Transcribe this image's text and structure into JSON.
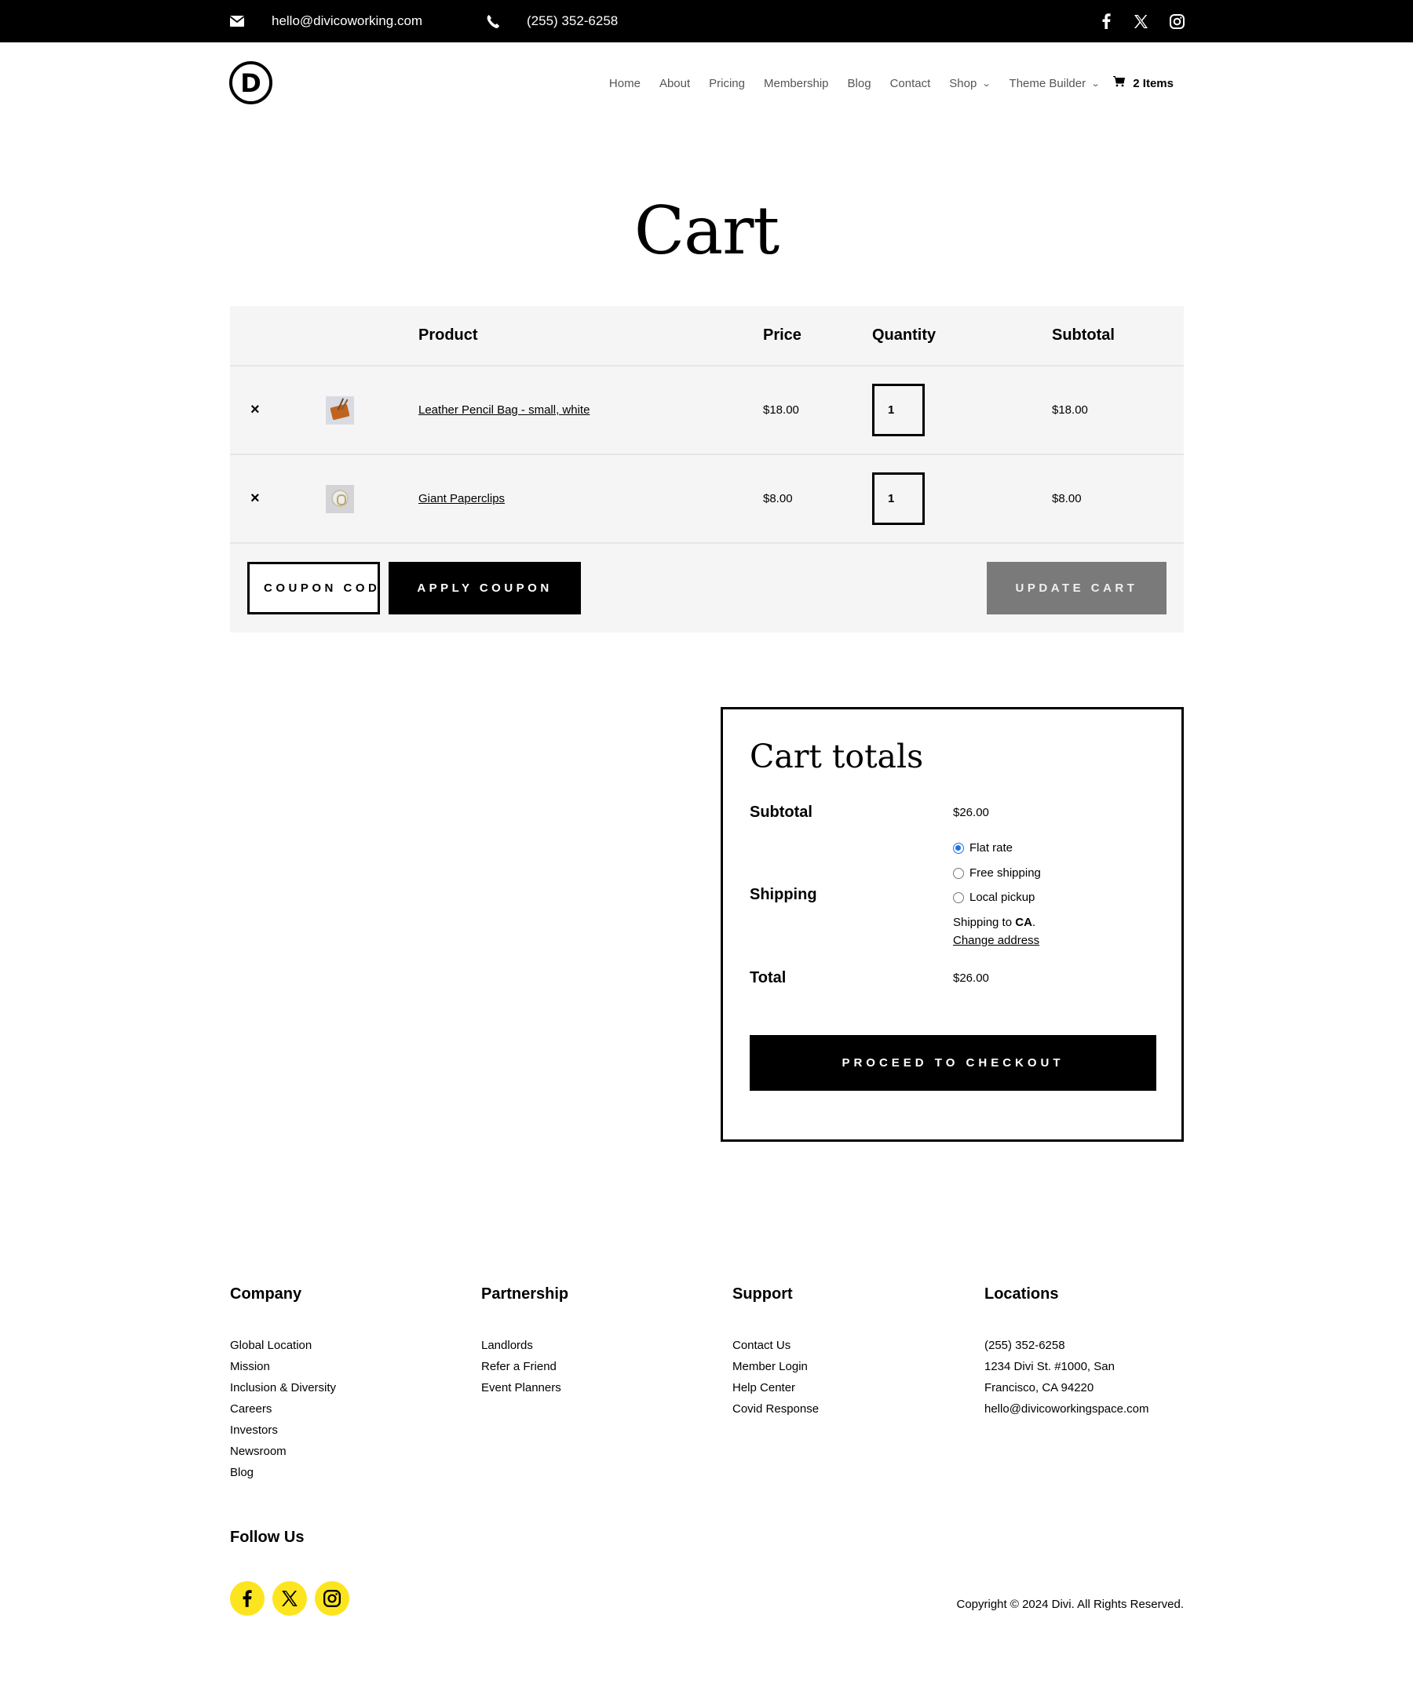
{
  "topbar": {
    "email": "hello@divicoworking.com",
    "phone": "(255) 352-6258",
    "icons": {
      "email": "envelope-icon",
      "phone": "phone-icon",
      "social": [
        "facebook-icon",
        "x-icon",
        "instagram-icon"
      ]
    }
  },
  "header": {
    "logo_letter": "D",
    "nav": [
      {
        "label": "Home",
        "dropdown": false
      },
      {
        "label": "About",
        "dropdown": false
      },
      {
        "label": "Pricing",
        "dropdown": false
      },
      {
        "label": "Membership",
        "dropdown": false
      },
      {
        "label": "Blog",
        "dropdown": false
      },
      {
        "label": "Contact",
        "dropdown": false
      },
      {
        "label": "Shop",
        "dropdown": true
      },
      {
        "label": "Theme Builder",
        "dropdown": true
      }
    ],
    "cart_label": "2 Items",
    "cart_icon": "shopping-cart-icon"
  },
  "page": {
    "title": "Cart"
  },
  "cart": {
    "columns": [
      "",
      "",
      "Product",
      "Price",
      "Quantity",
      "Subtotal"
    ],
    "items": [
      {
        "name": "Leather Pencil Bag - small, white",
        "price": "$18.00",
        "quantity": "1",
        "subtotal": "$18.00",
        "remove": "×"
      },
      {
        "name": "Giant Paperclips",
        "price": "$8.00",
        "quantity": "1",
        "subtotal": "$8.00",
        "remove": "×"
      }
    ],
    "coupon_placeholder": "COUPON CODE",
    "apply_coupon_label": "APPLY COUPON",
    "update_cart_label": "UPDATE CART"
  },
  "totals": {
    "title": "Cart totals",
    "subtotal_label": "Subtotal",
    "subtotal_value": "$26.00",
    "shipping_label": "Shipping",
    "shipping_options": [
      {
        "label": "Flat rate",
        "selected": true
      },
      {
        "label": "Free shipping",
        "selected": false
      },
      {
        "label": "Local pickup",
        "selected": false
      }
    ],
    "shipping_to_prefix": "Shipping to ",
    "shipping_to_region": "CA",
    "shipping_to_suffix": ".",
    "change_address_label": "Change address",
    "total_label": "Total",
    "total_value": "$26.00",
    "checkout_label": "PROCEED TO CHECKOUT",
    "accent_color": "#1a73e8"
  },
  "footer": {
    "columns": [
      {
        "heading": "Company",
        "links": [
          "Global Location",
          "Mission",
          "Inclusion & Diversity",
          "Careers",
          "Investors",
          "Newsroom",
          "Blog"
        ]
      },
      {
        "heading": "Partnership",
        "links": [
          "Landlords",
          "Refer a Friend",
          "Event Planners"
        ]
      },
      {
        "heading": "Support",
        "links": [
          "Contact Us",
          "Member Login",
          "Help Center",
          "Covid Response"
        ]
      },
      {
        "heading": "Locations",
        "links": [
          "(255) 352-6258",
          "1234 Divi St. #1000, San",
          "Francisco, CA 94220",
          "hello@divicoworkingspace.com"
        ]
      }
    ],
    "follow_heading": "Follow Us",
    "social_icons": [
      "facebook-icon",
      "x-icon",
      "instagram-icon"
    ],
    "social_color": "#fce51f",
    "copyright": "Copyright © 2024 Divi. All Rights Reserved."
  }
}
